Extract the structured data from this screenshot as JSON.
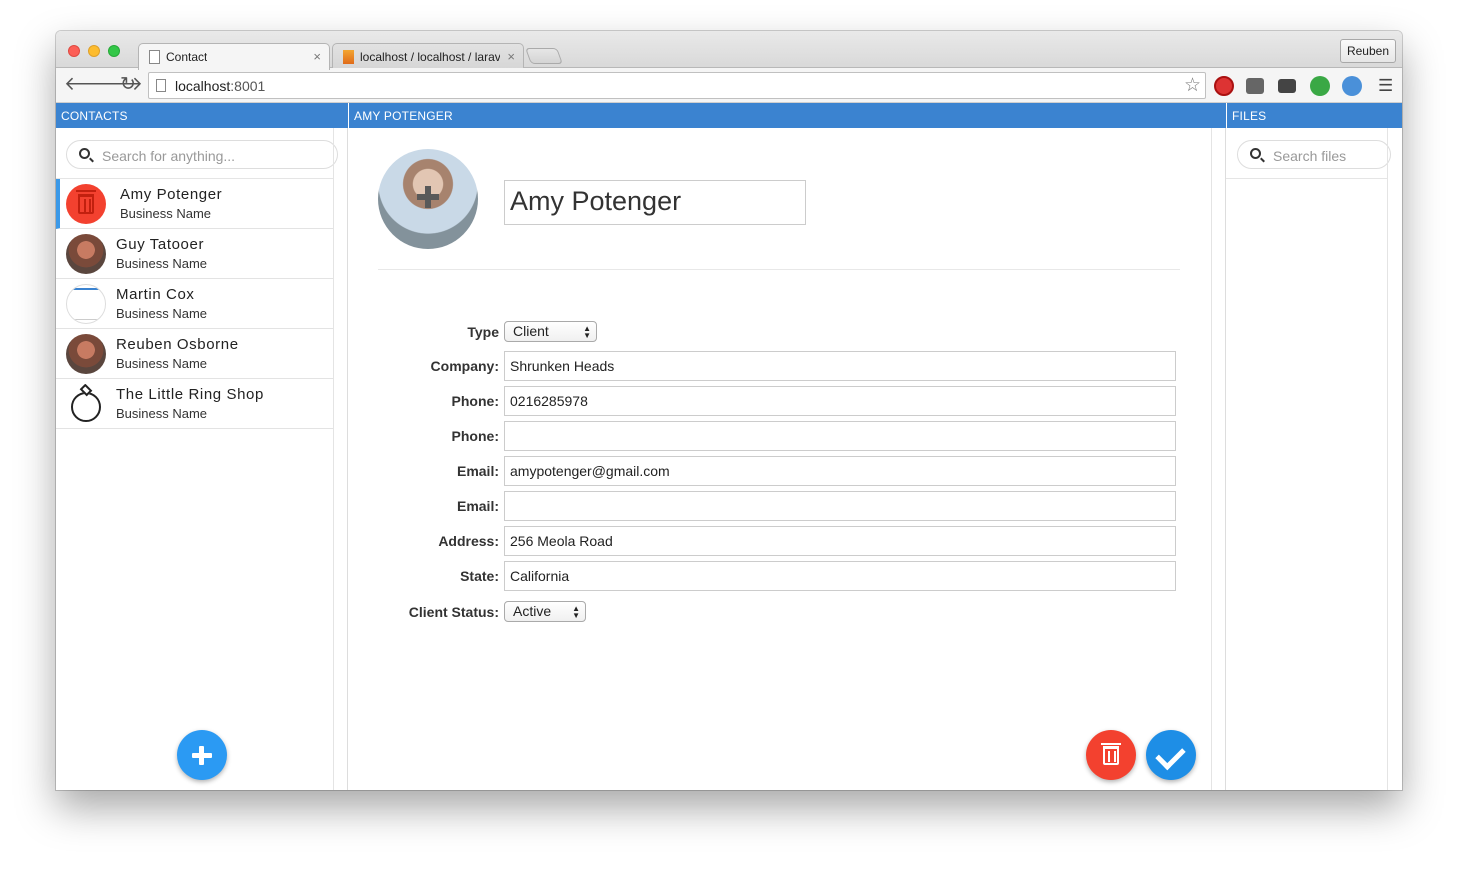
{
  "browser": {
    "tabs": [
      {
        "label": "Contact"
      },
      {
        "label": "localhost / localhost / larav"
      }
    ],
    "profile_name": "Reuben",
    "url_host": "localhost",
    "url_port": ":8001"
  },
  "contacts_panel": {
    "header": "CONTACTS",
    "search_placeholder": "Search for anything...",
    "items": [
      {
        "name": "Amy Potenger",
        "business": "Business Name",
        "selected": true
      },
      {
        "name": "Guy Tatooer",
        "business": "Business Name"
      },
      {
        "name": "Martin Cox",
        "business": "Business Name"
      },
      {
        "name": "Reuben Osborne",
        "business": "Business Name"
      },
      {
        "name": "The Little Ring Shop",
        "business": "Business Name"
      }
    ]
  },
  "detail_panel": {
    "header": "AMY POTENGER",
    "name": "Amy Potenger",
    "fields": {
      "type_label": "Type",
      "type_value": "Client",
      "company_label": "Company:",
      "company_value": "Shrunken Heads",
      "phone1_label": "Phone:",
      "phone1_value": "0216285978",
      "phone2_label": "Phone:",
      "phone2_value": "",
      "email1_label": "Email:",
      "email1_value": "amypotenger@gmail.com",
      "email2_label": "Email:",
      "email2_value": "",
      "address_label": "Address:",
      "address_value": "256 Meola Road",
      "state_label": "State:",
      "state_value": "California",
      "status_label": "Client Status:",
      "status_value": "Active"
    }
  },
  "files_panel": {
    "header": "FILES",
    "search_placeholder": "Search files"
  },
  "colors": {
    "header_blue": "#3b83d0",
    "add_button": "#2b9af3",
    "delete_button": "#f3412f",
    "save_button": "#1e8ee6"
  }
}
